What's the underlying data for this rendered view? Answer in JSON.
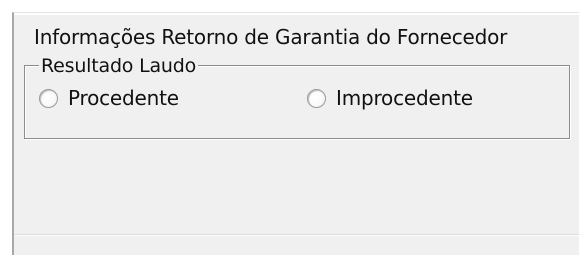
{
  "section": {
    "title": "Informações Retorno de Garantia do Fornecedor"
  },
  "group": {
    "legend": "Resultado Laudo",
    "options": [
      {
        "label": "Procedente",
        "selected": false
      },
      {
        "label": "Improcedente",
        "selected": false
      }
    ]
  }
}
